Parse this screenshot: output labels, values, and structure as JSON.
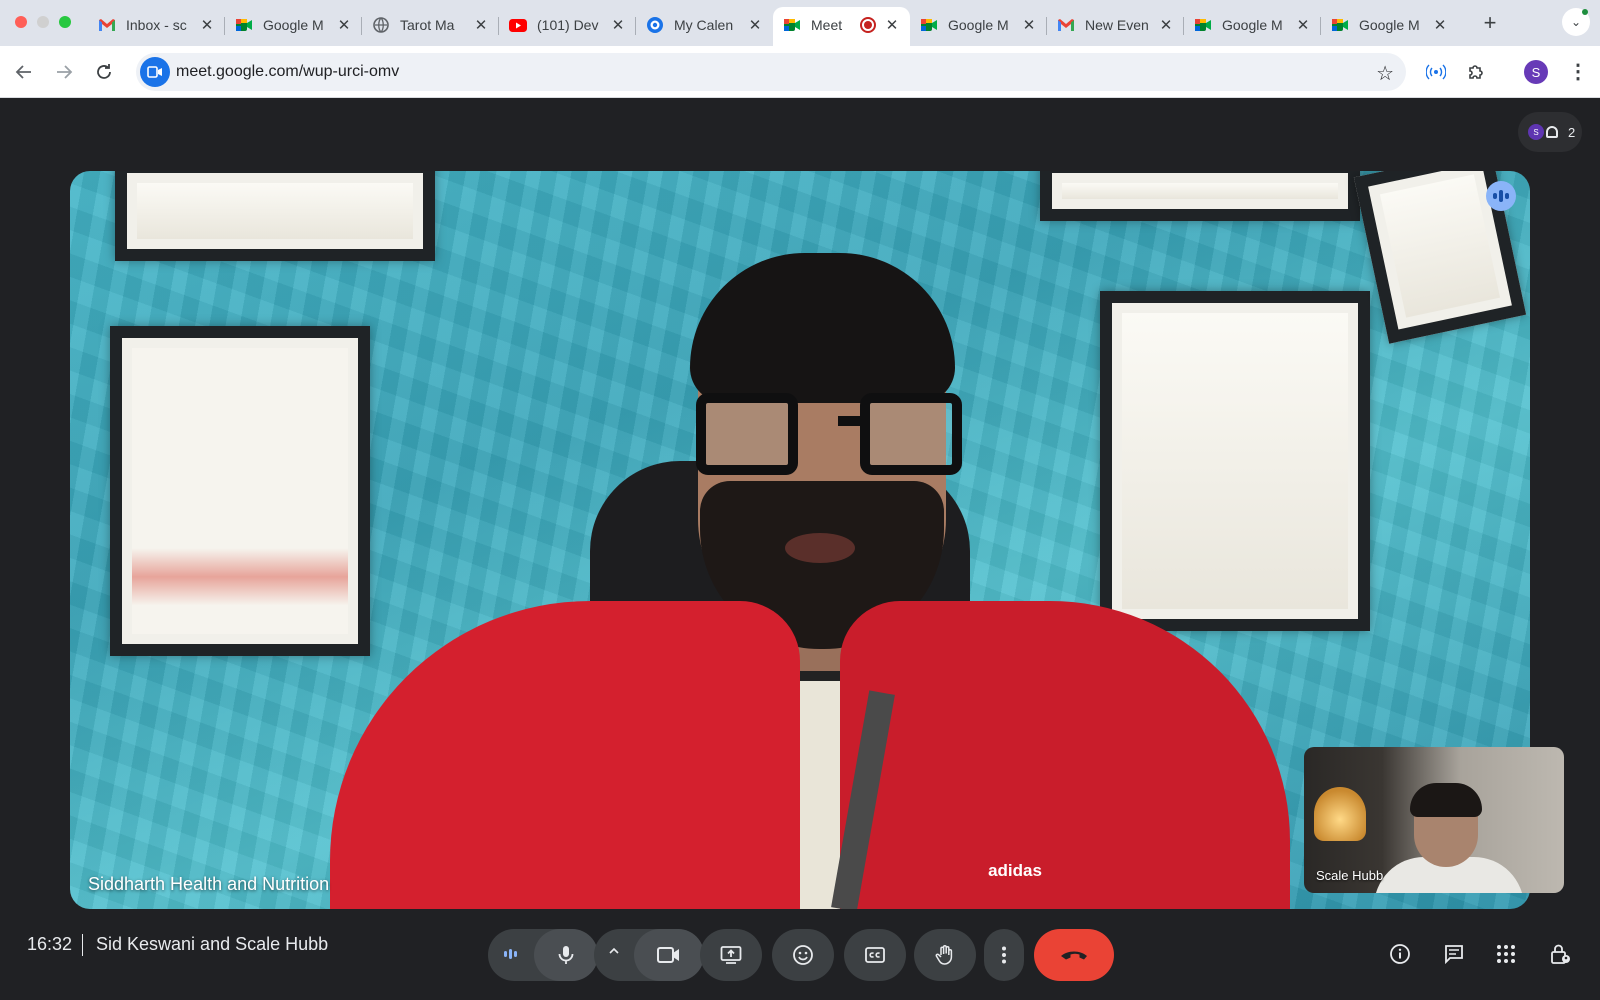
{
  "browser": {
    "tabs": [
      {
        "title": "Inbox - sc",
        "icon": "gmail-icon"
      },
      {
        "title": "Google M",
        "icon": "meet-icon"
      },
      {
        "title": "Tarot Ma",
        "icon": "globe-icon"
      },
      {
        "title": "(101) Dev",
        "icon": "youtube-icon"
      },
      {
        "title": "My Calen",
        "icon": "calendar-icon"
      },
      {
        "title": "Meet",
        "icon": "meet-icon",
        "active": true,
        "recording": true
      },
      {
        "title": "Google M",
        "icon": "meet-icon"
      },
      {
        "title": "New Even",
        "icon": "gmail-icon"
      },
      {
        "title": "Google M",
        "icon": "meet-icon"
      },
      {
        "title": "Google M",
        "icon": "meet-icon"
      }
    ],
    "url": "meet.google.com/wup-urci-omv",
    "profile_initial": "S"
  },
  "meet": {
    "participant_count": "2",
    "participant_avatar_initial": "S",
    "main_speaker_name": "Siddharth Health and Nutrition",
    "self_view_name": "Scale Hubb",
    "jacket_brand": "adidas",
    "time": "16:32",
    "meeting_title": "Sid Keswani and Scale Hubb"
  },
  "colors": {
    "background": "#202124",
    "control": "#3c4043",
    "end_call": "#ea4335",
    "speaking": "#8ab4f8"
  }
}
